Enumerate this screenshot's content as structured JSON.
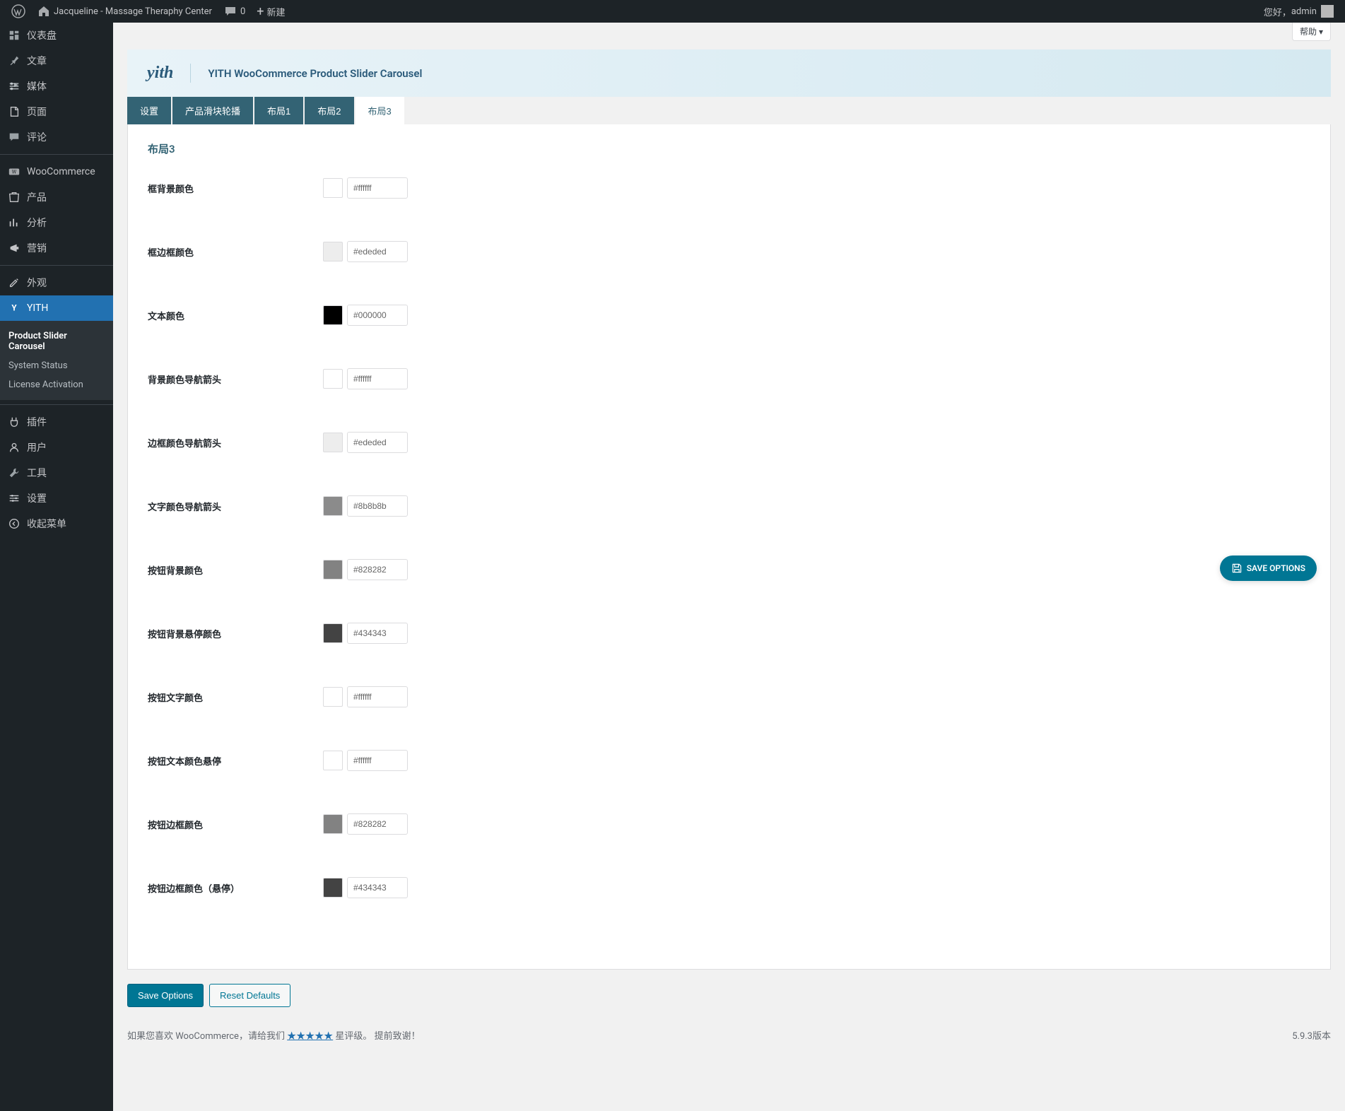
{
  "adminbar": {
    "site_name": "Jacqueline - Massage Theraphy Center",
    "comments": "0",
    "new": "新建",
    "greeting": "您好，",
    "user": "admin"
  },
  "sidebar": {
    "items": [
      {
        "label": "仪表盘",
        "icon": "dashboard"
      },
      {
        "label": "文章",
        "icon": "pin"
      },
      {
        "label": "媒体",
        "icon": "media"
      },
      {
        "label": "页面",
        "icon": "page"
      },
      {
        "label": "评论",
        "icon": "comment"
      },
      {
        "label": "WooCommerce",
        "icon": "woo"
      },
      {
        "label": "产品",
        "icon": "product"
      },
      {
        "label": "分析",
        "icon": "analytics"
      },
      {
        "label": "营销",
        "icon": "marketing"
      },
      {
        "label": "外观",
        "icon": "appearance"
      },
      {
        "label": "YITH",
        "icon": "yith"
      },
      {
        "label": "插件",
        "icon": "plugins"
      },
      {
        "label": "用户",
        "icon": "users"
      },
      {
        "label": "工具",
        "icon": "tools"
      },
      {
        "label": "设置",
        "icon": "settings"
      },
      {
        "label": "收起菜单",
        "icon": "collapse"
      }
    ],
    "submenu": [
      {
        "label": "Product Slider Carousel",
        "active": true
      },
      {
        "label": "System Status",
        "active": false
      },
      {
        "label": "License Activation",
        "active": false
      }
    ]
  },
  "help": "帮助",
  "plugin": {
    "logo": "yith",
    "title": "YITH WooCommerce Product Slider Carousel"
  },
  "tabs": [
    {
      "label": "设置",
      "active": false
    },
    {
      "label": "产品滑块轮播",
      "active": false
    },
    {
      "label": "布局1",
      "active": false
    },
    {
      "label": "布局2",
      "active": false
    },
    {
      "label": "布局3",
      "active": true
    }
  ],
  "section_title": "布局3",
  "fields": [
    {
      "label": "框背景颜色",
      "value": "#ffffff",
      "swatch": "#ffffff"
    },
    {
      "label": "框边框颜色",
      "value": "#ededed",
      "swatch": "#ededed"
    },
    {
      "label": "文本颜色",
      "value": "#000000",
      "swatch": "#000000"
    },
    {
      "label": "背景颜色导航箭头",
      "value": "#ffffff",
      "swatch": "#ffffff"
    },
    {
      "label": "边框颜色导航箭头",
      "value": "#ededed",
      "swatch": "#ededed"
    },
    {
      "label": "文字颜色导航箭头",
      "value": "#8b8b8b",
      "swatch": "#8b8b8b"
    },
    {
      "label": "按钮背景颜色",
      "value": "#828282",
      "swatch": "#828282"
    },
    {
      "label": "按钮背景悬停颜色",
      "value": "#434343",
      "swatch": "#434343"
    },
    {
      "label": "按钮文字颜色",
      "value": "#ffffff",
      "swatch": "#ffffff"
    },
    {
      "label": "按钮文本颜色悬停",
      "value": "#ffffff",
      "swatch": "#ffffff"
    },
    {
      "label": "按钮边框颜色",
      "value": "#828282",
      "swatch": "#828282"
    },
    {
      "label": "按钮边框颜色（悬停）",
      "value": "#434343",
      "swatch": "#434343"
    }
  ],
  "save_float": "SAVE OPTIONS",
  "buttons": {
    "save": "Save Options",
    "reset": "Reset Defaults"
  },
  "footer": {
    "text_prefix": "如果您喜欢 WooCommerce，请给我们 ",
    "stars": "★★★★★",
    "text_suffix": " 星评级。 提前致谢！",
    "version": "5.9.3版本"
  }
}
